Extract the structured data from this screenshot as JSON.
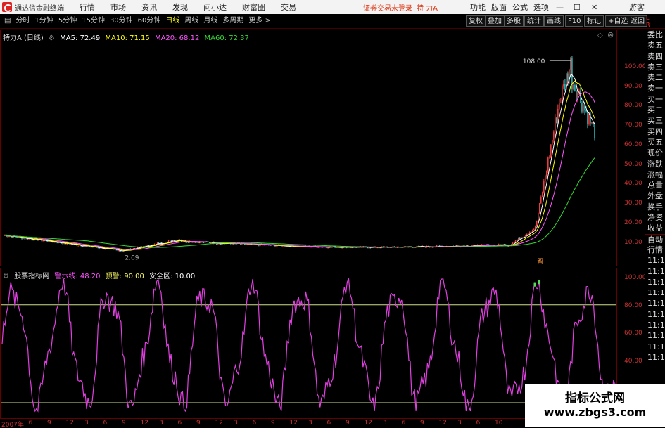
{
  "titlebar": {
    "app_name": "通达信金融终端",
    "menus": [
      "行情",
      "市场",
      "资讯",
      "发现",
      "问小达",
      "财富圈",
      "交易"
    ],
    "login_status": "证券交易未登录",
    "stock": "特 力A",
    "right_menus": [
      "功能",
      "版面",
      "公式",
      "选项"
    ],
    "guest": "游客"
  },
  "toolbar": {
    "periods": [
      "分时",
      "1分钟",
      "5分钟",
      "15分钟",
      "30分钟",
      "60分钟",
      "日线",
      "周线",
      "月线",
      "多周期",
      "更多 >"
    ],
    "active_period": "日线",
    "right_buttons": [
      "复权",
      "叠加",
      "多股",
      "统计",
      "画线",
      "F10",
      "标记",
      "+自选",
      "返回"
    ]
  },
  "main_chart": {
    "title": "特力A (日线)",
    "ma": [
      {
        "label": "MA5: 72.49",
        "color": "#ffffff"
      },
      {
        "label": "MA10: 71.15",
        "color": "#ffff00"
      },
      {
        "label": "MA20: 68.12",
        "color": "#ff55ff"
      },
      {
        "label": "MA60: 72.37",
        "color": "#33dd33"
      }
    ],
    "high_label": "108.00",
    "low_label": "2.69",
    "marker": "留",
    "ylim": [
      2,
      110
    ],
    "yticks": [
      "100.00",
      "90.00",
      "80.00",
      "70.00",
      "60.00",
      "50.00",
      "40.00",
      "30.00",
      "20.00",
      "10.00"
    ]
  },
  "indicator": {
    "title": "股票指标网",
    "fields": [
      {
        "label": "警示线: 48.20",
        "color": "#ff55ff"
      },
      {
        "label": "预警: 90.00",
        "color": "#ffff66"
      },
      {
        "label": "安全区: 10.00",
        "color": "#ffffff"
      }
    ],
    "ylim": [
      10,
      100
    ],
    "warn_level": 90,
    "safe_level": 10,
    "yticks": [
      "100.00",
      "80.00",
      "60.00",
      "40.00"
    ]
  },
  "side_panel": {
    "top": [
      "L",
      "R"
    ],
    "items": [
      "委比",
      "卖五",
      "卖四",
      "卖三",
      "卖二",
      "卖一",
      "买一",
      "买二",
      "买三",
      "买四",
      "买五",
      "现价",
      "涨跌",
      "涨幅",
      "总量",
      "外盘",
      "换手",
      "净资",
      "收益",
      "自动",
      "行情",
      "11:1",
      "11:1",
      "11:1",
      "11:1",
      "11:1",
      "11:1",
      "11:1",
      "11:1",
      "11:1",
      "11:1"
    ]
  },
  "xaxis": [
    "2007年",
    "6",
    "9",
    "12",
    "3",
    "6",
    "9",
    "12",
    "3",
    "6",
    "9",
    "12",
    "3",
    "6",
    "9",
    "12",
    "3",
    "6",
    "9",
    "12",
    "3",
    "6",
    "9",
    "12",
    "3",
    "6",
    "10"
  ],
  "watermark": {
    "line1": "指标公式网",
    "line2": "www.zbgs3.com"
  },
  "colors": {
    "up": "#ff3333",
    "down": "#33cccc",
    "accent": "#ffff00",
    "background": "#000000"
  }
}
